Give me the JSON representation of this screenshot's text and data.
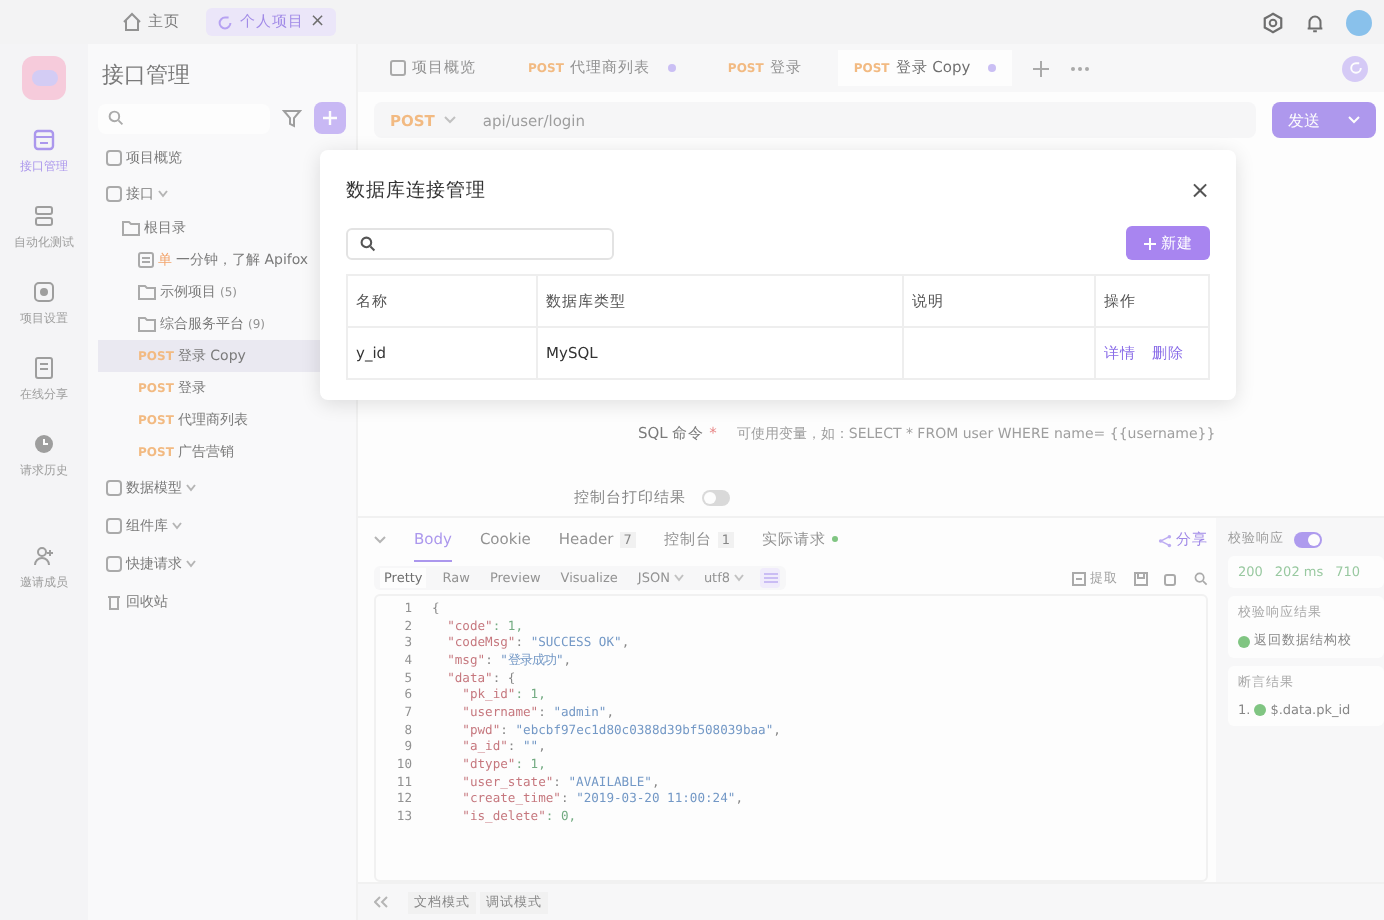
{
  "top_bar": {
    "tabs": [
      {
        "label": "主页",
        "kind": "home",
        "selected": false
      },
      {
        "label": "个人项目",
        "kind": "project",
        "selected": true,
        "close": "×"
      }
    ]
  },
  "rail": {
    "items": [
      {
        "label": "接口管理",
        "kind": "api",
        "selected": true
      },
      {
        "label": "自动化测试",
        "kind": "test",
        "selected": false
      },
      {
        "label": "项目设置",
        "kind": "settings",
        "selected": false
      },
      {
        "label": "在线分享",
        "kind": "share",
        "selected": false
      },
      {
        "label": "请求历史",
        "kind": "history",
        "selected": false
      },
      {
        "label": "邀请成员",
        "kind": "invite",
        "selected": false
      }
    ]
  },
  "sidebar": {
    "title": "接口管理",
    "tree": [
      {
        "label": "项目概览",
        "kind": "overview"
      },
      {
        "label": "接口",
        "kind": "section",
        "children": [
          {
            "label": "根目录",
            "kind": "folder",
            "children": [
              {
                "label": "一分钟，了解 Apifox",
                "kind": "doc",
                "badge": "单"
              },
              {
                "label": "示例项目",
                "kind": "folder",
                "count": "(5)"
              },
              {
                "label": "综合服务平台",
                "kind": "folder",
                "count": "(9)"
              },
              {
                "label": "登录 Copy",
                "kind": "request",
                "method": "POST",
                "selected": true
              },
              {
                "label": "登录",
                "kind": "request",
                "method": "POST",
                "selected": false
              },
              {
                "label": "代理商列表",
                "kind": "request",
                "method": "POST",
                "selected": false
              },
              {
                "label": "广告营销",
                "kind": "request",
                "method": "POST",
                "selected": false
              }
            ]
          }
        ]
      },
      {
        "label": "数据模型",
        "kind": "section"
      },
      {
        "label": "组件库",
        "kind": "section"
      },
      {
        "label": "快捷请求",
        "kind": "section"
      },
      {
        "label": "回收站",
        "kind": "trash"
      }
    ]
  },
  "tabs": [
    {
      "label": "项目概览",
      "kind": "overview",
      "selected": false,
      "unsaved": false
    },
    {
      "label": "代理商列表",
      "kind": "request",
      "method": "POST",
      "selected": false,
      "unsaved": true
    },
    {
      "label": "登录",
      "kind": "request",
      "method": "POST",
      "selected": false,
      "unsaved": false
    },
    {
      "label": "登录 Copy",
      "kind": "request",
      "method": "POST",
      "selected": true,
      "unsaved": true
    }
  ],
  "request": {
    "method": "POST",
    "url": "api/user/login",
    "send": "发送"
  },
  "sql": {
    "label": "SQL 命令",
    "required": "*",
    "placeholder": "可使用变量，如：SELECT * FROM user WHERE name= {{username}}"
  },
  "console_print": {
    "label": "控制台打印结果",
    "on": false
  },
  "response": {
    "tabs": [
      {
        "label": "Body",
        "selected": true,
        "indicator": false
      },
      {
        "label": "Cookie",
        "selected": false,
        "indicator": false
      },
      {
        "label": "Header",
        "count": "7",
        "selected": false,
        "indicator": false
      },
      {
        "label": "控制台",
        "count": "1",
        "selected": false,
        "indicator": false
      },
      {
        "label": "实际请求",
        "selected": false,
        "indicator": true
      }
    ],
    "share": "分享",
    "formats": [
      {
        "label": "Pretty",
        "kind": "tab",
        "selected": true
      },
      {
        "label": "Raw",
        "kind": "tab",
        "selected": false
      },
      {
        "label": "Preview",
        "kind": "tab",
        "selected": false
      },
      {
        "label": "Visualize",
        "kind": "tab",
        "selected": false
      },
      {
        "label": "JSON",
        "kind": "select",
        "selected": false
      },
      {
        "label": "utf8",
        "kind": "select",
        "selected": false
      }
    ],
    "extract": "提取",
    "code": [
      {
        "n": "1",
        "text": "{"
      },
      {
        "n": "2",
        "text": "  \"code\": 1,"
      },
      {
        "n": "3",
        "text": "  \"codeMsg\": \"SUCCESS OK\","
      },
      {
        "n": "4",
        "text": "  \"msg\": \"登录成功\","
      },
      {
        "n": "5",
        "text": "  \"data\": {"
      },
      {
        "n": "6",
        "text": "    \"pk_id\": 1,"
      },
      {
        "n": "7",
        "text": "    \"username\": \"admin\","
      },
      {
        "n": "8",
        "text": "    \"pwd\": \"ebcbf97ec1d80c0388d39bf508039baa\","
      },
      {
        "n": "9",
        "text": "    \"a_id\": \"\","
      },
      {
        "n": "10",
        "text": "    \"dtype\": 1,"
      },
      {
        "n": "11",
        "text": "    \"user_state\": \"AVAILABLE\","
      },
      {
        "n": "12",
        "text": "    \"create_time\": \"2019-03-20 11:00:24\","
      },
      {
        "n": "13",
        "text": "    \"is_delete\": 0,"
      }
    ]
  },
  "footer": {
    "modes": [
      {
        "label": "文档模式",
        "selected": false
      },
      {
        "label": "调试模式",
        "selected": false
      }
    ]
  },
  "right_panel": {
    "validate": {
      "label": "校验响应",
      "on": true
    },
    "stats": [
      "200",
      "202 ms",
      "710"
    ],
    "validation_title": "校验响应结果",
    "validation_item": "返回数据结构校",
    "assert_title": "断言结果",
    "assert_index": "1.",
    "assert_item": "$.data.pk_id"
  },
  "dialog": {
    "title": "数据库连接管理",
    "close": "×",
    "new_button": "新建",
    "columns": [
      "名称",
      "数据库类型",
      "说明",
      "操作"
    ],
    "rows": [
      {
        "name": "y_id",
        "type": "MySQL",
        "actions": [
          "详情",
          "删除"
        ]
      }
    ]
  }
}
